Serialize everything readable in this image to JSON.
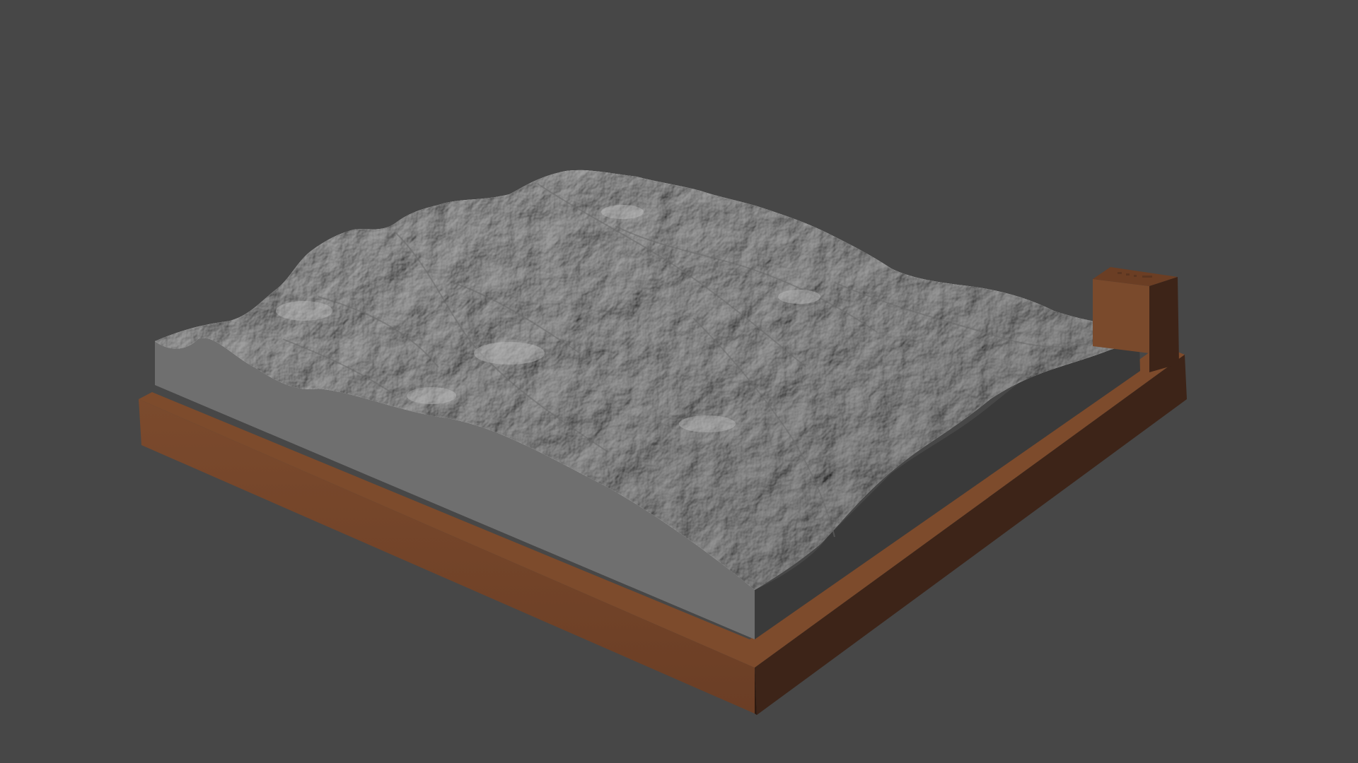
{
  "viewport": {
    "background_color": "#474747",
    "scene": {
      "terrain_color": "#8d8d8d",
      "terrain_side_light_color": "#6f6f6f",
      "terrain_side_dark_color": "#393939",
      "base_color": "#75452a",
      "base_side_dark_color": "#3e2417",
      "label_block_color": "#7a4a2c"
    }
  }
}
